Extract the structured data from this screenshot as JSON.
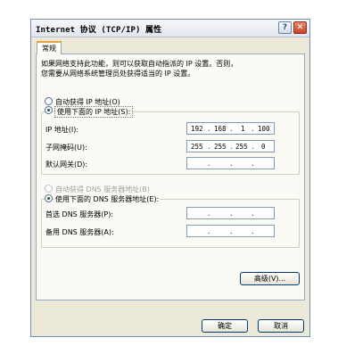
{
  "dialog": {
    "title": "Internet 协议 (TCP/IP) 属性",
    "help_label": "?",
    "close_label": "✕"
  },
  "tab": {
    "label": "常规"
  },
  "description": {
    "line1": "如果网络支持此功能，则可以获取自动指派的 IP 设置。否则，",
    "line2": "您需要从网络系统管理员处获得适当的 IP 设置。"
  },
  "ip": {
    "auto_label": "自动获得 IP 地址(O)",
    "manual_label": "使用下面的 IP 地址(S):",
    "selected": "manual",
    "address_label": "IP 地址(I):",
    "address": [
      "192",
      "168",
      "1",
      "100"
    ],
    "mask_label": "子网掩码(U):",
    "mask": [
      "255",
      "255",
      "255",
      "0"
    ],
    "gateway_label": "默认网关(D):",
    "gateway": [
      "",
      "",
      "",
      ""
    ]
  },
  "dns": {
    "auto_label": "自动获得 DNS 服务器地址(B)",
    "manual_label": "使用下面的 DNS 服务器地址(E):",
    "selected": "manual",
    "preferred_label": "首选 DNS 服务器(P):",
    "preferred": [
      "",
      "",
      "",
      ""
    ],
    "alternate_label": "备用 DNS 服务器(A):",
    "alternate": [
      "",
      "",
      "",
      ""
    ]
  },
  "buttons": {
    "advanced": "高级(V)...",
    "ok": "确定",
    "cancel": "取消"
  }
}
